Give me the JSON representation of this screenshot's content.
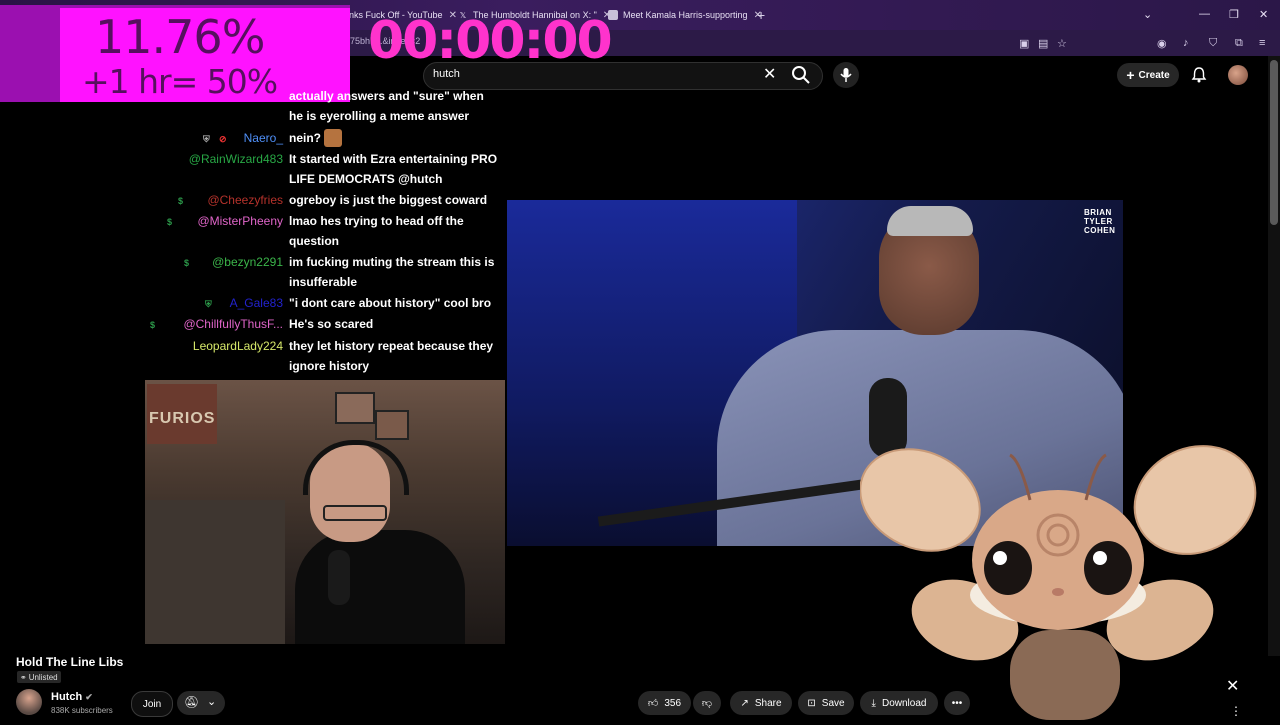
{
  "browser": {
    "tabs": [
      {
        "label": "nks Fuck Off - YouTube",
        "icon": "youtube-icon"
      },
      {
        "label": "The Humboldt Hannibal on X: \"",
        "icon": "x-icon"
      },
      {
        "label": "Meet Kamala Harris-supporting",
        "icon": "page-icon"
      }
    ],
    "url": "75bh7...&index=2"
  },
  "overlay": {
    "percent": "11.76%",
    "hour_note": "+1 hr= 50%",
    "timer": "00:00:00"
  },
  "youtube_header": {
    "search_value": "hutch",
    "create_label": "Create"
  },
  "chat": [
    {
      "user": "",
      "message": "actually answers and \"sure\" when he is eyerolling a meme answer",
      "color": "#ffffff"
    },
    {
      "user": "Naero_",
      "message": "nein?",
      "color": "#4f8ff7"
    },
    {
      "user": "@RainWizard483",
      "message": "It started with Ezra entertaining PRO LIFE DEMOCRATS @hutch",
      "color": "#28a745"
    },
    {
      "user": "@Cheezyfries",
      "message": "ogreboy is just the biggest coward",
      "color": "#b5322b"
    },
    {
      "user": "@MisterPheeny",
      "message": "lmao hes trying to head off the question",
      "color": "#e065c9"
    },
    {
      "user": "@bezyn2291",
      "message": "im fucking muting the stream this is insufferable",
      "color": "#3bb54a"
    },
    {
      "user": "A_Gale83",
      "message": "\"i dont care about history\" cool bro",
      "color": "#2222cc"
    },
    {
      "user": "@ChillfullyThusF...",
      "message": "He's so scared",
      "color": "#e065c9"
    },
    {
      "user": "LeopardLady224",
      "message": "they let history repeat because they ignore history",
      "color": "#d6e86a"
    }
  ],
  "video": {
    "watermark_lines": [
      "BRIAN",
      "TYLER",
      "COHEN"
    ]
  },
  "webcam": {
    "poster_text": "FURIOS"
  },
  "video_info": {
    "title": "Hold The Line Libs",
    "visibility": "Unlisted",
    "channel": "Hutch",
    "subscribers": "838K subscribers",
    "join_label": "Join",
    "like_count": "356",
    "share_label": "Share",
    "save_label": "Save",
    "download_label": "Download"
  }
}
